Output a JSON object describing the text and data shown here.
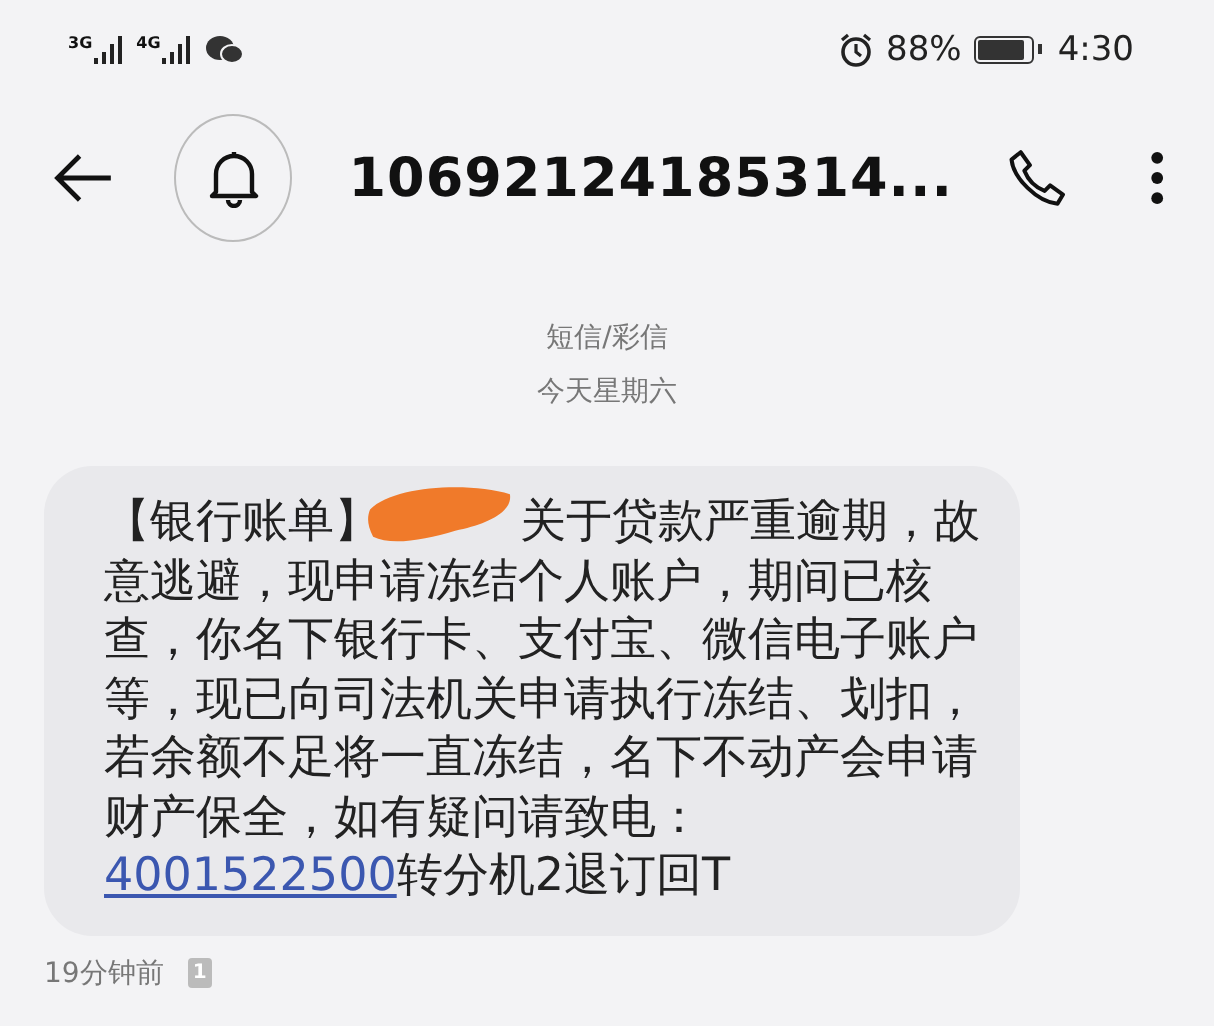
{
  "status_bar": {
    "networks": [
      "3G",
      "4G"
    ],
    "battery_percent": "88%",
    "time": "4:30"
  },
  "header": {
    "title": "10692124185314..."
  },
  "thread": {
    "channel": "短信/彩信",
    "date": "今天星期六"
  },
  "message": {
    "before_redaction": "【银行账单】",
    "redacted": true,
    "after_redaction": "关于贷款严重逾期，故意逃避，现申请冻结个人账户，期间已核查，你名下银行卡、支付宝、微信电子账户等，现已向司法机关申请执行冻结、划扣，若余额不足将一直冻结，名下不动产会申请财产保全，如有疑问请致电：",
    "phone_link": "4001522500",
    "tail": "转分机2退订回T",
    "time": "19分钟前",
    "sim": "1"
  }
}
